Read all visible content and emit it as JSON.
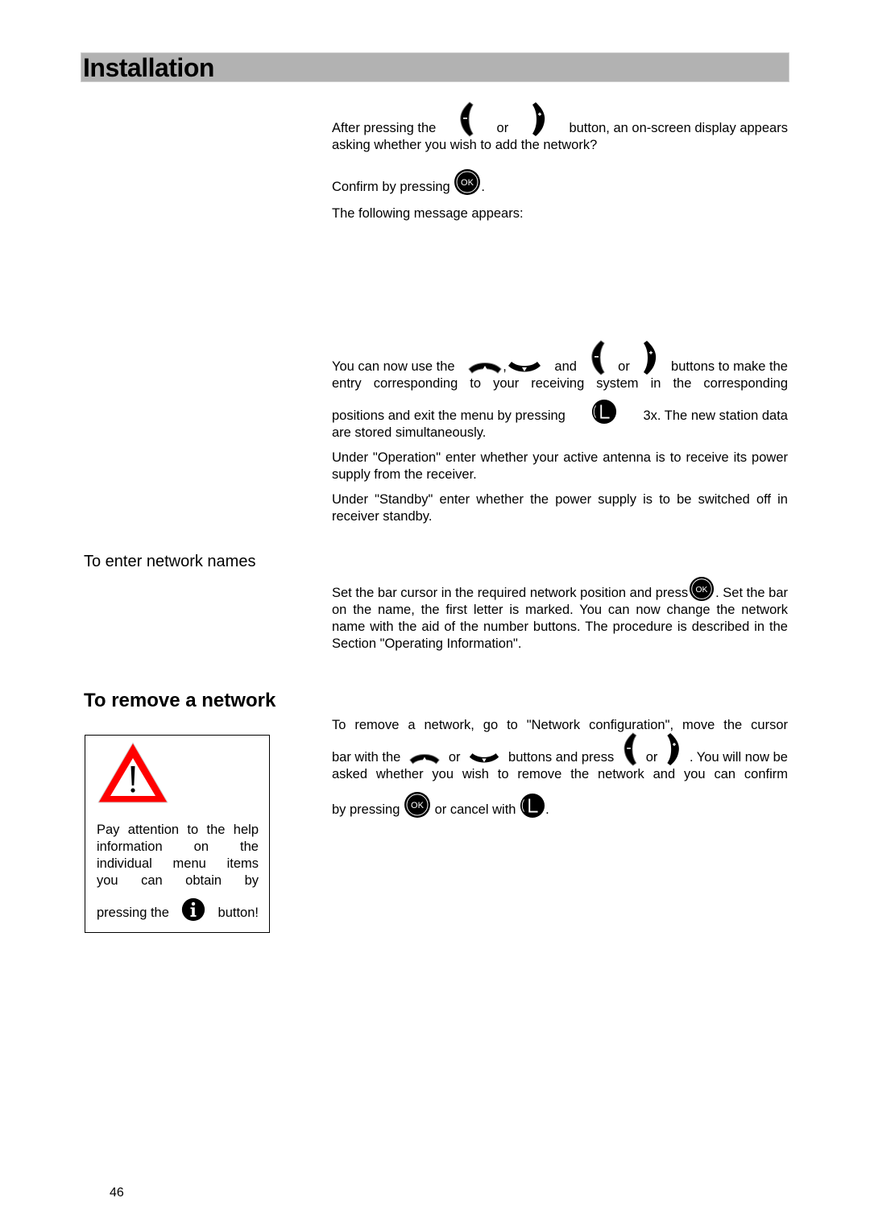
{
  "header": {
    "title": "Installation"
  },
  "section1": {
    "para1": {
      "before": "After pressing the",
      "mid": "or",
      "after": "button, an on-screen display appears",
      "line2": "asking whether you wish to add the network?"
    },
    "para2": {
      "before": "Confirm by pressing",
      "after": "."
    },
    "para3": "The following message appears:",
    "para4": {
      "a": "You can now use the",
      "comma": ",",
      "b": "and",
      "c": "or",
      "d": "buttons to make the",
      "line2": "entry corresponding to your receiving system in the corresponding",
      "line3_before": "positions and exit the menu by pressing",
      "line3_after": "3x. The new station data",
      "line4": "are stored simultaneously."
    },
    "para5": "Under \"Operation\" enter whether your active antenna is to receive its power supply from the receiver.",
    "para6": "Under \"Standby\" enter whether the power supply is to be switched off in receiver standby."
  },
  "section2": {
    "heading": "To enter network names",
    "para": {
      "before": "Set the bar cursor in the required network position and press",
      "after": ". Set the bar on the name, the first letter is marked. You can now change the network name with the aid of the number buttons. The procedure is described in the Section \"Operating Information\"."
    }
  },
  "section3": {
    "heading": "To remove a network",
    "para": {
      "line1": "To remove a network, go to \"Network configuration\", move the cursor",
      "a": "bar with the",
      "b": "or",
      "c": "buttons and press",
      "d": "or",
      "e": ". You will now be",
      "line3": "asked whether you wish to remove the network and you can confirm",
      "f": "by pressing",
      "g": "or cancel with",
      "h": "."
    }
  },
  "warning": {
    "lines": [
      "Pay attention to the help",
      "information on the",
      "individual menu items",
      "you can obtain by"
    ],
    "last_before": "pressing the",
    "last_after": "button!",
    "colors": {
      "triangle": "#ff0000",
      "fill": "#ffffff"
    }
  },
  "icons": {
    "ok_label": "OK",
    "exit_label": "L",
    "info_label": "i",
    "minus_label": "−",
    "plus_label": "+"
  },
  "footer": {
    "page_number": "46"
  }
}
